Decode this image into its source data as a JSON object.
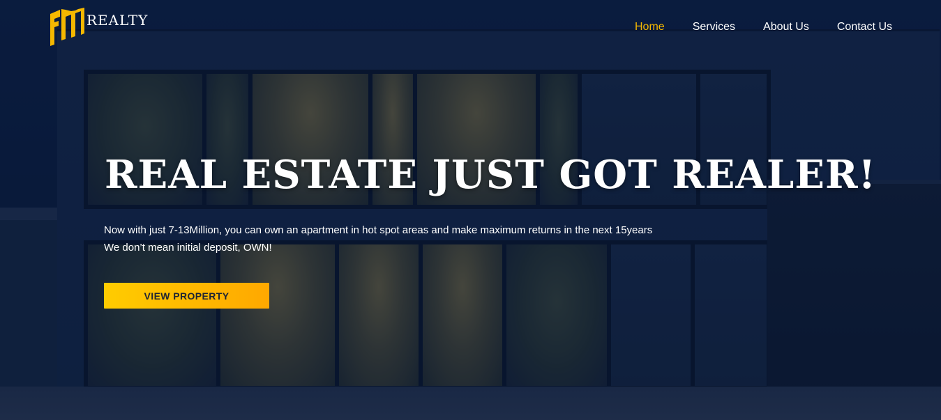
{
  "brand": {
    "name": "REALTY",
    "logo_color": "#f5b800"
  },
  "nav": {
    "items": [
      {
        "label": "Home",
        "active": true
      },
      {
        "label": "Services",
        "active": false
      },
      {
        "label": "About Us",
        "active": false
      },
      {
        "label": "Contact Us",
        "active": false
      }
    ]
  },
  "hero": {
    "headline": "REAL ESTATE JUST GOT REALER!",
    "line1": "Now with just 7-13Million, you can own an apartment in hot spot areas and make maximum returns in the next 15years",
    "line2": "We don’t mean initial deposit, OWN!",
    "cta_label": "VIEW PROPERTY",
    "background_image": "modern two-story house at night with lit windows"
  },
  "colors": {
    "accent": "#f5b800",
    "button_start": "#ffcc00",
    "button_end": "#ffa800",
    "overlay": "#08183a"
  }
}
